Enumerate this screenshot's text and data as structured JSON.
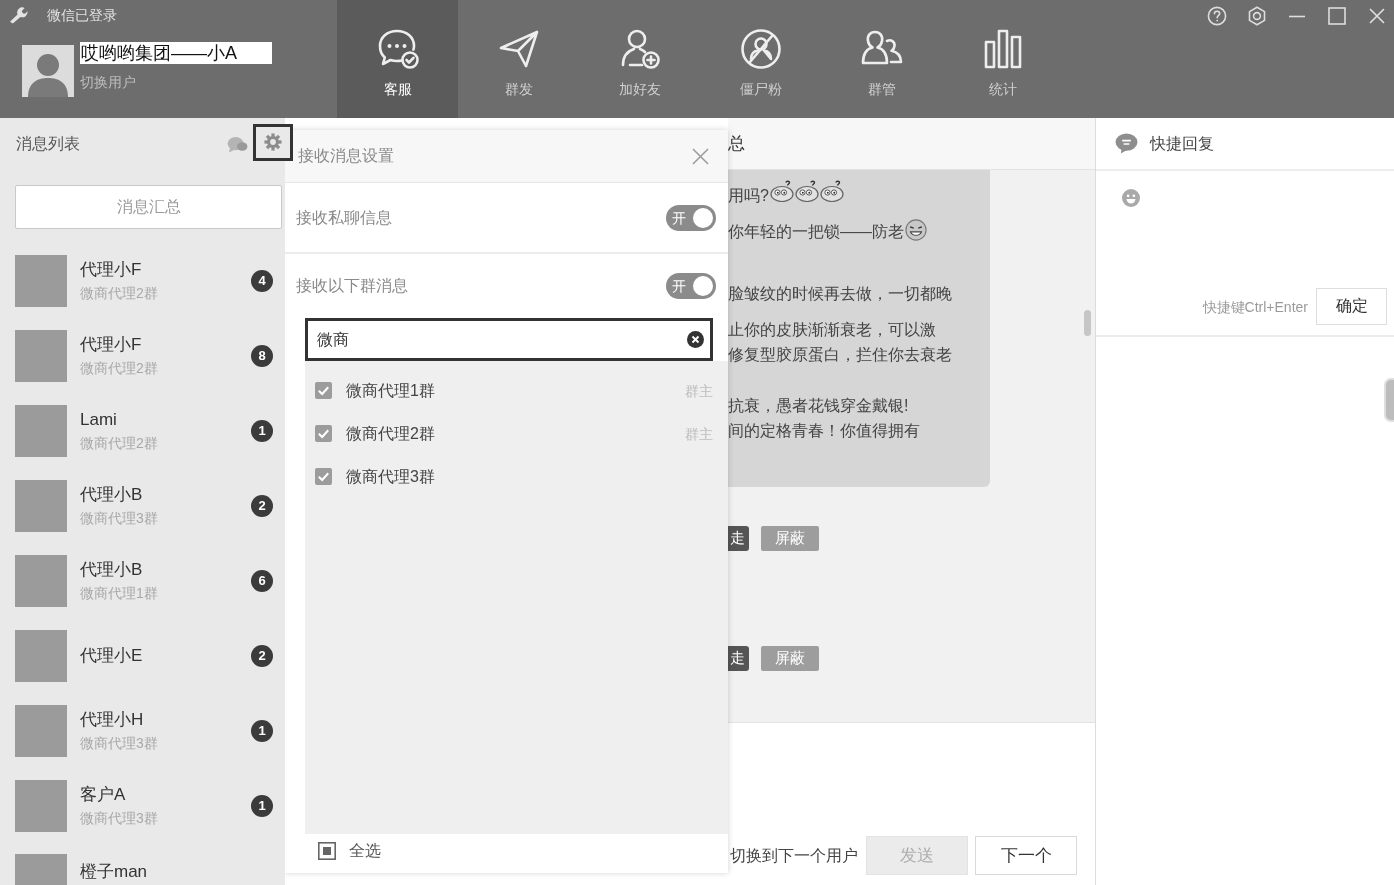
{
  "window": {
    "title": "微信已登录"
  },
  "account": {
    "name": "哎哟哟集团——小A",
    "switch_label": "切换用户"
  },
  "nav_tabs": [
    {
      "label": "客服",
      "kind": "service",
      "selected": true
    },
    {
      "label": "群发",
      "kind": "broadcast",
      "selected": false
    },
    {
      "label": "加好友",
      "kind": "addfriend",
      "selected": false
    },
    {
      "label": "僵尸粉",
      "kind": "zombie",
      "selected": false
    },
    {
      "label": "群管",
      "kind": "groups",
      "selected": false
    },
    {
      "label": "统计",
      "kind": "stats",
      "selected": false
    }
  ],
  "message_list": {
    "title": "消息列表",
    "summary_button": "消息汇总",
    "items": [
      {
        "name": "代理小F",
        "group": "微商代理2群",
        "unread": "4"
      },
      {
        "name": "代理小F",
        "group": "微商代理2群",
        "unread": "8"
      },
      {
        "name": "Lami",
        "group": "微商代理2群",
        "unread": "1"
      },
      {
        "name": "代理小B",
        "group": "微商代理3群",
        "unread": "2"
      },
      {
        "name": "代理小B",
        "group": "微商代理1群",
        "unread": "6"
      },
      {
        "name": "代理小E",
        "unread": "2"
      },
      {
        "name": "代理小H",
        "group": "微商代理3群",
        "unread": "1"
      },
      {
        "name": "客户A",
        "group": "微商代理3群",
        "unread": "1"
      },
      {
        "name": "橙子man"
      }
    ]
  },
  "receive_settings": {
    "title": "接收消息设置",
    "private_messages": {
      "label": "接收私聊信息",
      "toggle_label": "开",
      "on": true
    },
    "group_messages": {
      "label": "接收以下群消息",
      "toggle_label": "开",
      "on": true
    },
    "search": {
      "value": "微商"
    },
    "groups": [
      {
        "name": "微商代理1群",
        "checked": true,
        "tag": "群主"
      },
      {
        "name": "微商代理2群",
        "checked": true,
        "tag": "群主"
      },
      {
        "name": "微商代理3群",
        "checked": true
      }
    ],
    "select_all": {
      "label": "全选",
      "checked": true
    }
  },
  "chat": {
    "title": "总",
    "paragraphs": [
      {
        "lines": [
          {
            "text": "用吗?",
            "emojis": [
              {
                "kind": "dizzy"
              },
              {
                "kind": "dizzy"
              },
              {
                "kind": "dizzy"
              }
            ]
          }
        ]
      },
      {
        "lines": [
          {
            "text": "你年轻的一把锁——防老",
            "emojis": [
              {
                "kind": "grin"
              }
            ]
          }
        ]
      },
      {
        "lines": [
          {
            "text": "脸皱纹的时候再去做，一切都晚"
          }
        ]
      },
      {
        "lines": [
          {
            "text": "止你的皮肤渐渐衰老，可以激"
          },
          {
            "text": "修复型胶原蛋白，拦住你去衰老"
          }
        ]
      },
      {
        "lines": [
          {
            "text": "抗衰，愚者花钱穿金戴银!"
          },
          {
            "text": "间的定格青春！你值得拥有"
          }
        ]
      }
    ],
    "actions": [
      {
        "kick": "走",
        "block": "屏蔽"
      },
      {
        "kick": "走",
        "block": "屏蔽"
      }
    ],
    "switch_hint": "切换到下一个用户",
    "send_button": {
      "label": "发送",
      "disabled": true
    },
    "next_button": "下一个"
  },
  "quick_reply": {
    "title": "快捷回复",
    "shortcut_hint": "快捷键Ctrl+Enter",
    "confirm_button": "确定"
  }
}
